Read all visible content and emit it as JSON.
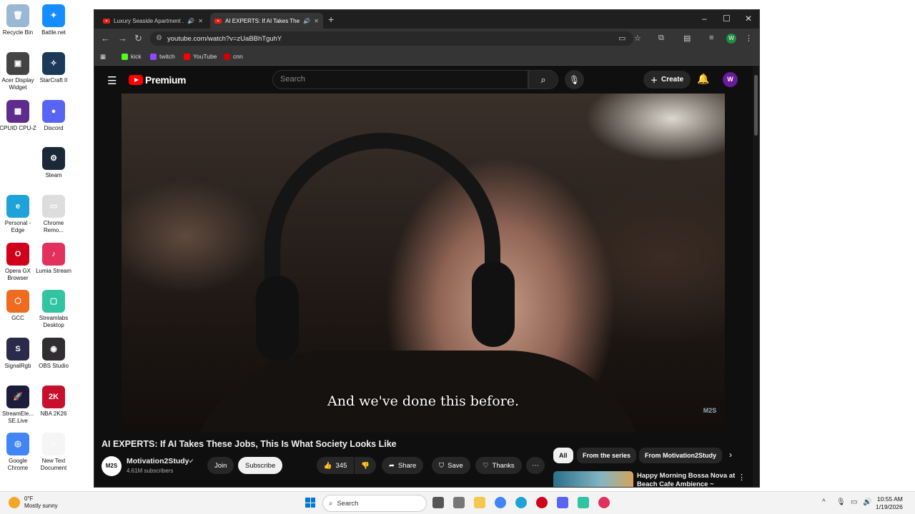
{
  "desktop": {
    "icons": [
      {
        "label": "Recycle Bin",
        "color": "#9ab8d4",
        "glyph": "🗑"
      },
      {
        "label": "Battle.net",
        "color": "#148eff",
        "glyph": "✦"
      },
      {
        "label": "Acer Display Widget",
        "color": "#444444",
        "glyph": "▣"
      },
      {
        "label": "StarCraft II",
        "color": "#1b3a5a",
        "glyph": "✧"
      },
      {
        "label": "CPUID CPU-Z",
        "color": "#5d2c8c",
        "glyph": "▦"
      },
      {
        "label": "Discord",
        "color": "#5865f2",
        "glyph": "●"
      },
      {
        "label": "Steam",
        "color": "#1b2838",
        "glyph": "⚙"
      },
      {
        "label": "Personal - Edge",
        "color": "#1fa2d8",
        "glyph": "e"
      },
      {
        "label": "Chrome Remo...",
        "color": "#dddddd",
        "glyph": "▭"
      },
      {
        "label": "Opera GX Browser",
        "color": "#d0021b",
        "glyph": "O"
      },
      {
        "label": "Lumia Stream",
        "color": "#e2315d",
        "glyph": "♪"
      },
      {
        "label": "GCC",
        "color": "#ef6b1f",
        "glyph": "⬡"
      },
      {
        "label": "Streamlabs Desktop",
        "color": "#31c3a2",
        "glyph": "▢"
      },
      {
        "label": "SignalRgb",
        "color": "#2a2a4a",
        "glyph": "S"
      },
      {
        "label": "OBS Studio",
        "color": "#302e31",
        "glyph": "◉"
      },
      {
        "label": "StreamEle... SE.Live",
        "color": "#1c1c3c",
        "glyph": "🚀"
      },
      {
        "label": "NBA 2K26",
        "color": "#c8102e",
        "glyph": "2K"
      },
      {
        "label": "Google Chrome",
        "color": "#4285f4",
        "glyph": "◎"
      },
      {
        "label": "New Text Document",
        "color": "#f5f5f5",
        "glyph": "≡"
      }
    ]
  },
  "browser": {
    "tabs": [
      {
        "title": "Luxury Seaside Apartment ...",
        "audio": "🔊",
        "close": "✕"
      },
      {
        "title": "AI EXPERTS: If AI Takes The...",
        "audio": "🔊",
        "close": "✕"
      }
    ],
    "new_tab": "+",
    "window_controls": {
      "minimize": "–",
      "maximize": "☐",
      "close": "✕"
    },
    "nav": {
      "back": "←",
      "forward": "→",
      "reload": "↻"
    },
    "url": "youtube.com/watch?v=zUaBBhTguhY",
    "profile_initial": "W",
    "bookmarks": [
      {
        "label": "kick",
        "color": "#53fc18"
      },
      {
        "label": "twitch",
        "color": "#9146ff"
      },
      {
        "label": "YouTube",
        "color": "#ff0000"
      },
      {
        "label": "cnn",
        "color": "#cc0000"
      }
    ]
  },
  "youtube": {
    "logo_text": "Premium",
    "search_placeholder": "Search",
    "create_label": "Create",
    "avatar_initial": "W",
    "caption": "And we've done this before.",
    "watermark": "M2S",
    "video_title": "AI EXPERTS: If AI Takes These Jobs, This Is What Society Looks Like",
    "channel": {
      "avatar_text": "M2S",
      "name": "Motivation2Study",
      "subscribers": "4.61M subscribers",
      "verified": "✔"
    },
    "join_label": "Join",
    "subscribe_label": "Subscribe",
    "like_count": "345",
    "share_label": "Share",
    "save_label": "Save",
    "thanks_label": "Thanks",
    "chips": [
      "All",
      "From the series",
      "From Motivation2Study"
    ],
    "recommended": {
      "title": "Happy Morning Bossa Nova at Beach Cafe Ambience ~"
    }
  },
  "taskbar": {
    "weather_temp": "0°F",
    "weather_desc": "Mostly sunny",
    "search_label": "Search",
    "time": "10:55 AM",
    "date": "1/19/2026"
  }
}
